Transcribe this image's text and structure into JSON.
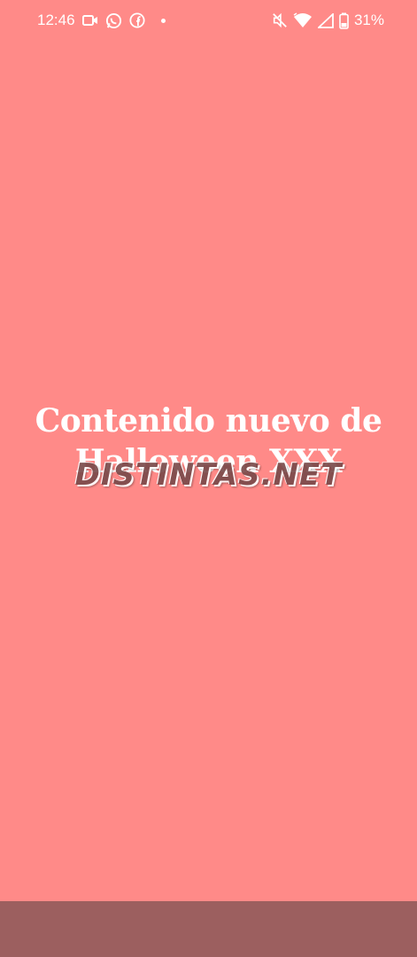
{
  "status_bar": {
    "time": "12:46",
    "battery": "31%",
    "left_icons": [
      "video-camera-icon",
      "whatsapp-icon",
      "facebook-icon",
      "notification-dot-icon"
    ],
    "right_icons": [
      "muted-icon",
      "wifi-icon",
      "signal-icon",
      "battery-icon"
    ]
  },
  "main": {
    "headline": "Contenido nuevo de Halloween XXX"
  },
  "watermark": {
    "text": "DISTINTAS.NET"
  },
  "colors": {
    "background": "#ff8a88",
    "nav_bar": "#9c5f5f",
    "text": "#ffffff"
  }
}
